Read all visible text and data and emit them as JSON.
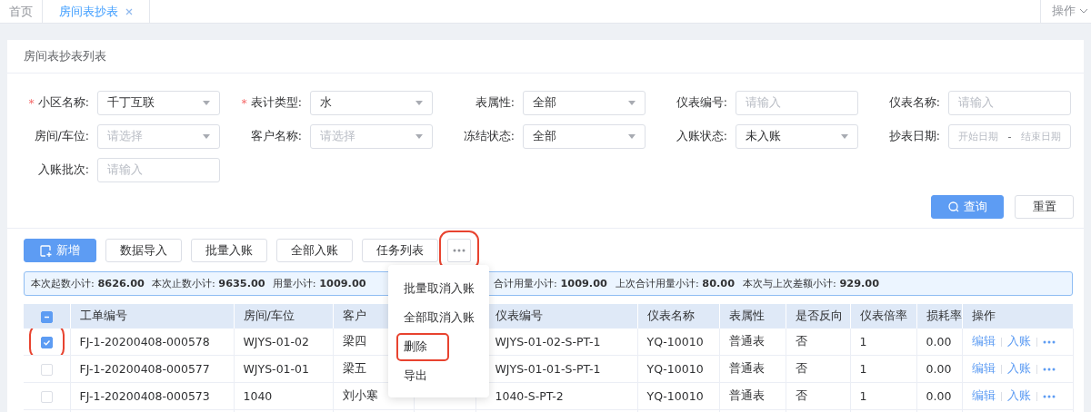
{
  "tabs": [
    {
      "label": "首页",
      "selected": false,
      "closable": false
    },
    {
      "label": "房间表抄表",
      "selected": true,
      "closable": true
    }
  ],
  "tab_actions": {
    "label": "操作"
  },
  "card": {
    "title": "房间表抄表列表"
  },
  "filters": [
    {
      "label": "小区名称:",
      "required_mark": "*",
      "kind": "select",
      "value": "千丁互联"
    },
    {
      "label": "表计类型:",
      "required_mark": "*",
      "kind": "select",
      "value": "水"
    },
    {
      "label": "表属性:",
      "kind": "select",
      "value": "全部"
    },
    {
      "label": "仪表编号:",
      "kind": "input",
      "placeholder": "请输入"
    },
    {
      "label": "仪表名称:",
      "kind": "input",
      "placeholder": "请输入"
    },
    {
      "label": "房间/车位:",
      "kind": "select",
      "placeholder": "请选择"
    },
    {
      "label": "客户名称:",
      "kind": "select",
      "placeholder": "请选择"
    },
    {
      "label": "冻结状态:",
      "kind": "select",
      "value": "全部"
    },
    {
      "label": "入账状态:",
      "kind": "select",
      "value": "未入账"
    },
    {
      "label": "抄表日期:",
      "kind": "daterange",
      "start_placeholder": "开始日期",
      "separator": "-",
      "end_placeholder": "结束日期"
    },
    {
      "label": "入账批次:",
      "kind": "input",
      "placeholder": "请输入"
    }
  ],
  "form_buttons": [
    {
      "label": "查询",
      "kind": "primary"
    },
    {
      "label": "重置",
      "kind": "default"
    }
  ],
  "toolbar": [
    {
      "label": "新增",
      "kind": "primary",
      "annotated": false
    },
    {
      "label": "数据导入",
      "kind": "default",
      "annotated": false
    },
    {
      "label": "批量入账",
      "kind": "default",
      "annotated": false
    },
    {
      "label": "全部入账",
      "kind": "default",
      "annotated": false
    },
    {
      "label": "任务列表",
      "kind": "default",
      "annotated": false
    },
    {
      "kind": "more",
      "annotated": true
    }
  ],
  "summary": {
    "items_left": [
      {
        "label": "本次起数小计:",
        "value": "8626.00"
      },
      {
        "label": "本次止数小计:",
        "value": "9635.00"
      },
      {
        "label": "用量小计:",
        "value": "1009.00"
      }
    ],
    "items_right": [
      {
        "label": "合计用量小计:",
        "value": "1009.00"
      },
      {
        "label": "上次合计用量小计:",
        "value": "80.00"
      },
      {
        "label": "本次与上次差额小计:",
        "value": "929.00"
      }
    ]
  },
  "table": {
    "select_all": {
      "indeterminate": true
    },
    "columns": [
      "工单编号",
      "房间/车位",
      "客户",
      "仪表编号",
      "仪表名称",
      "表属性",
      "是否反向",
      "仪表倍率",
      "损耗率",
      "操作"
    ],
    "rows": [
      {
        "checked": true,
        "annotated": true,
        "cells": [
          "FJ-1-20200408-000578",
          "WJYS-01-02",
          "梁四",
          "WJYS-01-02-S-PT-1",
          "YQ-10010",
          "普通表",
          "否",
          "1",
          "0.00"
        ],
        "actions": [
          "编辑",
          "入账"
        ]
      },
      {
        "checked": false,
        "annotated": false,
        "cells": [
          "FJ-1-20200408-000577",
          "WJYS-01-01",
          "梁五",
          "WJYS-01-01-S-PT-1",
          "YQ-10010",
          "普通表",
          "否",
          "1",
          "0.00"
        ],
        "actions": [
          "编辑",
          "入账"
        ]
      },
      {
        "checked": false,
        "annotated": false,
        "cells": [
          "FJ-1-20200408-000573",
          "1040",
          "刘小寒",
          "1040-S-PT-2",
          "YQ-10010",
          "普通表",
          "否",
          "1",
          "0.00"
        ],
        "actions": [
          "编辑",
          "入账"
        ]
      }
    ]
  },
  "more_menu": {
    "items": [
      {
        "label": "批量取消入账",
        "annotated": false
      },
      {
        "label": "全部取消入账",
        "annotated": false
      },
      {
        "label": "删除",
        "annotated": true
      },
      {
        "label": "导出",
        "annotated": false
      }
    ]
  }
}
